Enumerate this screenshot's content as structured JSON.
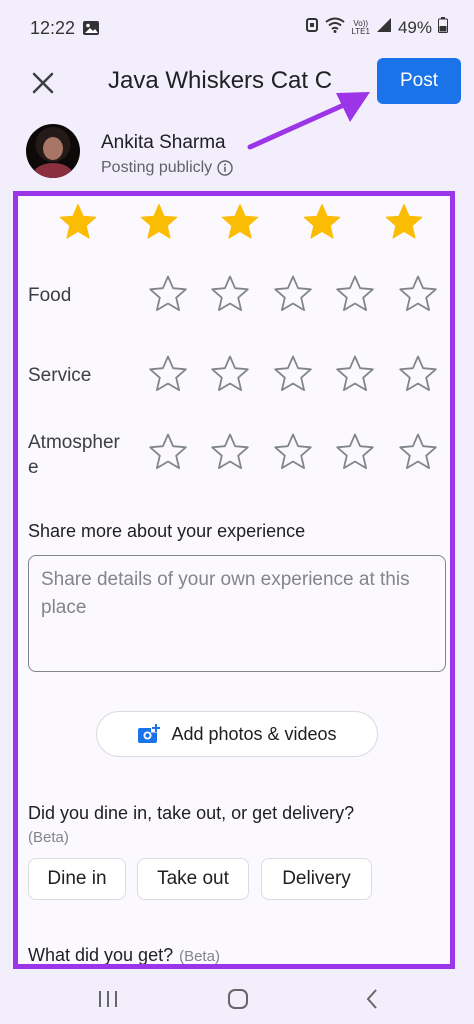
{
  "status_bar": {
    "time": "12:22",
    "network_top": "Vo))",
    "network_bottom": "LTE1",
    "battery": "49%"
  },
  "header": {
    "close_icon": "close-icon",
    "title": "Java Whiskers Cat C",
    "post_label": "Post"
  },
  "author": {
    "name": "Ankita Sharma",
    "visibility": "Posting publicly",
    "info_icon": "info-icon"
  },
  "rating": {
    "overall_value": 5,
    "overall_max": 5,
    "categories": [
      {
        "label": "Food",
        "value": 0
      },
      {
        "label": "Service",
        "value": 0
      },
      {
        "label": "Atmospher e",
        "value": 0
      }
    ]
  },
  "review": {
    "section_title": "Share more about your experience",
    "placeholder": "Share details of your own experience at this place",
    "value": ""
  },
  "media": {
    "add_label": "Add photos & videos",
    "icon": "add-photo-icon"
  },
  "dining": {
    "question": "Did you dine in, take out, or get delivery?",
    "beta": "(Beta)",
    "options": [
      "Dine in",
      "Take out",
      "Delivery"
    ]
  },
  "next_question": {
    "label": "What did you get?",
    "beta": "(Beta)"
  },
  "colors": {
    "accent": "#1a73e8",
    "star_filled": "#fbbc04",
    "star_empty": "#80868b",
    "highlight": "#9c35e8"
  },
  "nav": {
    "recent_icon": "recent-apps-icon",
    "home_icon": "home-icon",
    "back_icon": "back-icon"
  }
}
